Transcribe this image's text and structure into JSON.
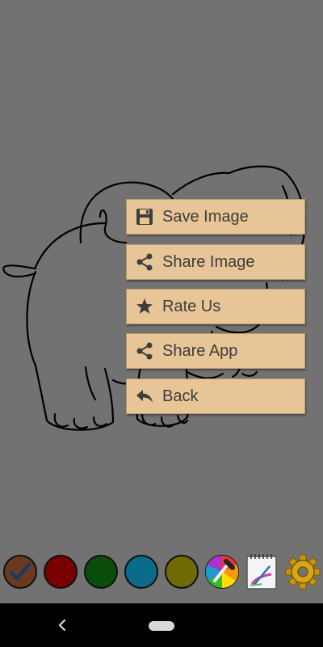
{
  "menu": {
    "items": [
      {
        "label": "Save Image",
        "icon": "save-icon"
      },
      {
        "label": "Share Image",
        "icon": "share-icon"
      },
      {
        "label": "Rate Us",
        "icon": "star-icon"
      },
      {
        "label": "Share App",
        "icon": "share-icon"
      },
      {
        "label": "Back",
        "icon": "back-arrow-icon"
      }
    ]
  },
  "palette": {
    "colors": [
      "#6b3a1e",
      "#7a0000",
      "#0a4d0a",
      "#0a6b8a",
      "#6f6a06"
    ],
    "selected_index": 0,
    "tools": [
      "color-picker-icon",
      "brush-notepad-icon",
      "settings-gear-icon"
    ]
  },
  "colors": {
    "background": "#727272",
    "menu_item_bg": "#e8c596",
    "menu_text": "#3d3d3d",
    "nav_bar": "#000000"
  }
}
